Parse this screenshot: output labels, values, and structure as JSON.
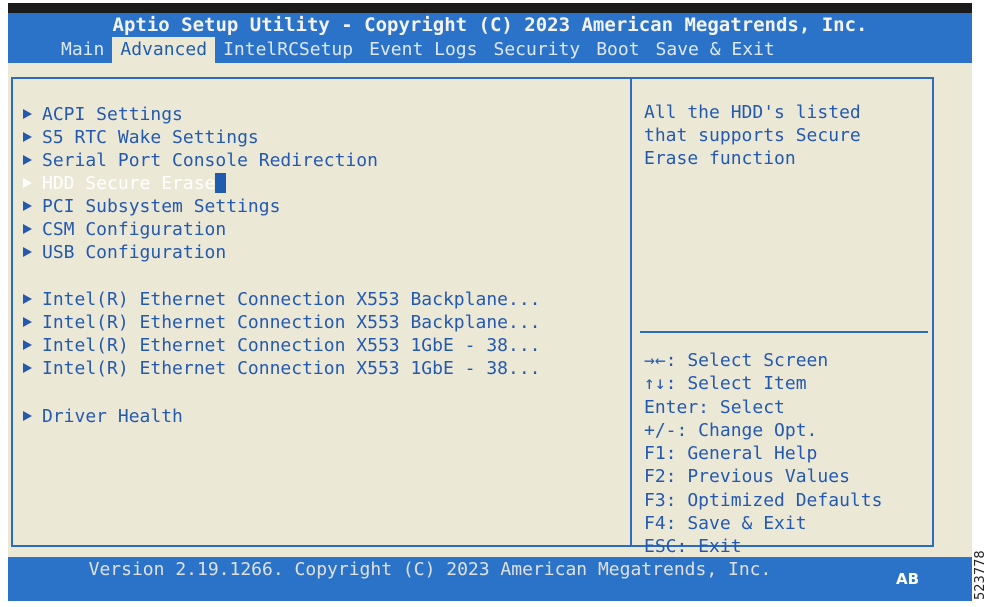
{
  "title": "Aptio Setup Utility - Copyright (C) 2023 American Megatrends, Inc.",
  "menu_tabs": [
    "Main",
    "Advanced",
    "IntelRCSetup",
    "Event Logs",
    "Security",
    "Boot",
    "Save & Exit"
  ],
  "active_tab": "Advanced",
  "menu_items": [
    "ACPI Settings",
    "S5 RTC Wake Settings",
    "Serial Port Console Redirection",
    "HDD Secure Erase",
    "PCI Subsystem Settings",
    "CSM Configuration",
    "USB Configuration",
    "Intel(R) Ethernet Connection X553 Backplane...",
    "Intel(R) Ethernet Connection X553 Backplane...",
    "Intel(R) Ethernet Connection X553 1GbE - 38...",
    "Intel(R) Ethernet Connection X553 1GbE - 38...",
    "Driver Health"
  ],
  "selected_item": "HDD Secure Erase",
  "help_lines": [
    "All the HDD's listed",
    "that supports Secure",
    "Erase function"
  ],
  "key_help": [
    "→←: Select Screen",
    "↑↓: Select Item",
    "Enter: Select",
    "+/-: Change Opt.",
    "F1: General Help",
    "F2: Previous Values",
    "F3: Optimized Defaults",
    "F4: Save & Exit",
    "ESC: Exit"
  ],
  "version": "Version 2.19.1266. Copyright (C) 2023 American Megatrends, Inc.",
  "badge": "AB",
  "doc_number": "523778",
  "colors": {
    "bios_blue": "#2b73c9",
    "panel_bg": "#ece8d6",
    "item_text": "#2459b0"
  }
}
